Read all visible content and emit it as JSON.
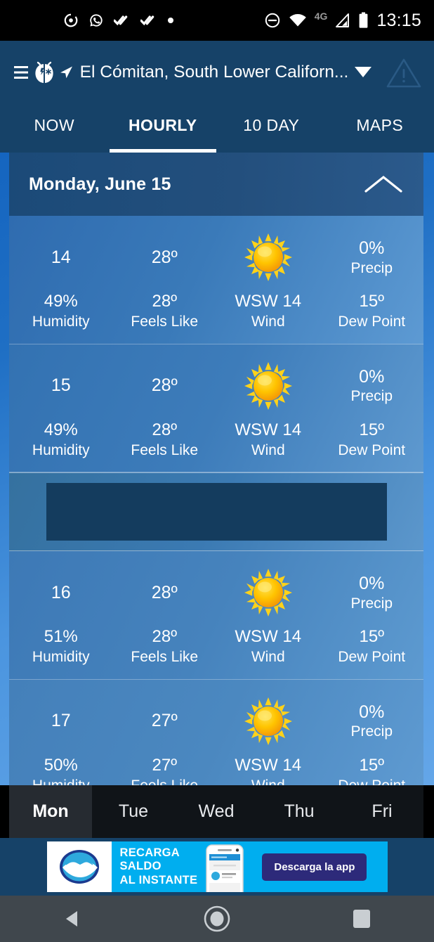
{
  "status_bar": {
    "left_icons": [
      "podcast-icon",
      "whatsapp-icon",
      "double-check-icon",
      "double-check-icon",
      "dot-icon"
    ],
    "right_icons": [
      "do-not-disturb-icon",
      "wifi-icon",
      "signal-icon",
      "battery-icon"
    ],
    "network": "4G",
    "clock": "13:15"
  },
  "app_bar": {
    "menu_icon": "hamburger-menu-icon",
    "logo_icon": "weatherbug-ladybug-icon",
    "location_arrow_icon": "location-arrow-icon",
    "location": "El Cómitan, South Lower Californ...",
    "dropdown_icon": "caret-down-icon",
    "alert_icon": "alert-triangle-icon"
  },
  "tabs": [
    {
      "label": "NOW",
      "active": false
    },
    {
      "label": "HOURLY",
      "active": true
    },
    {
      "label": "10 DAY",
      "active": false
    },
    {
      "label": "MAPS",
      "active": false
    }
  ],
  "day_header": {
    "title": "Monday, June 15",
    "collapse_icon": "chevron-up-icon"
  },
  "labels": {
    "precip": "Precip",
    "humidity": "Humidity",
    "feels_like": "Feels Like",
    "wind": "Wind",
    "dew_point": "Dew Point"
  },
  "hours": [
    {
      "time": "14",
      "temp": "28º",
      "condition_icon": "sun-icon",
      "precip": "0%",
      "humidity": "49%",
      "feels_like": "28º",
      "wind": "WSW 14",
      "dew_point": "15º"
    },
    {
      "time": "15",
      "temp": "28º",
      "condition_icon": "sun-icon",
      "precip": "0%",
      "humidity": "49%",
      "feels_like": "28º",
      "wind": "WSW 14",
      "dew_point": "15º"
    },
    {
      "time": "16",
      "temp": "28º",
      "condition_icon": "sun-icon",
      "precip": "0%",
      "humidity": "51%",
      "feels_like": "28º",
      "wind": "WSW 14",
      "dew_point": "15º"
    },
    {
      "time": "17",
      "temp": "27º",
      "condition_icon": "sun-icon",
      "precip": "0%",
      "humidity": "50%",
      "feels_like": "27º",
      "wind": "WSW 14",
      "dew_point": "15º"
    }
  ],
  "day_selector": [
    {
      "label": "Mon",
      "selected": true
    },
    {
      "label": "Tue",
      "selected": false
    },
    {
      "label": "Wed",
      "selected": false
    },
    {
      "label": "Thu",
      "selected": false
    },
    {
      "label": "Fri",
      "selected": false
    }
  ],
  "ad": {
    "logo_icon": "handshake-icon",
    "line1": "RECARGA",
    "line2": "SALDO",
    "line3": "AL INSTANTE",
    "phone_icon": "phone-mockup-icon",
    "cta": "Descarga la app"
  },
  "nav_bar": {
    "back_icon": "back-triangle-icon",
    "home_icon": "home-circle-icon",
    "recents_icon": "recents-square-icon"
  }
}
